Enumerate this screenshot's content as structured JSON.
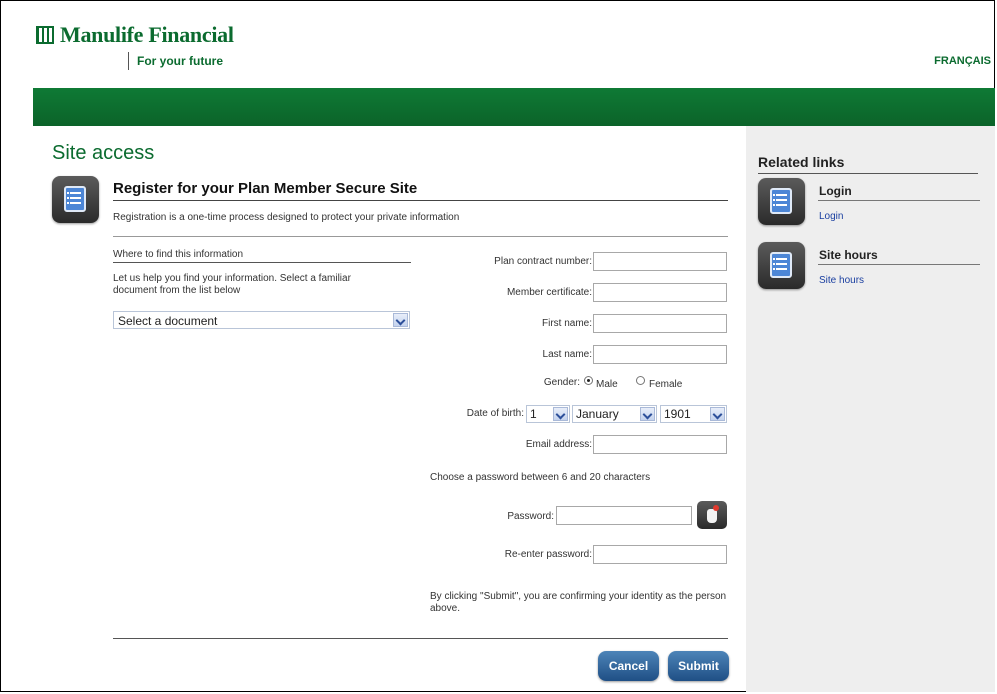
{
  "header": {
    "brand": "Manulife Financial",
    "tagline": "For your future",
    "language_link": "FRANÇAIS",
    "brand_color": "#0b6b2f"
  },
  "main": {
    "page_title": "Site access",
    "section_title": "Register for your Plan Member Secure Site",
    "intro": "Registration is a one-time process designed to protect your private information",
    "where_heading": "Where to find this information",
    "where_text": "Let us help you find your information. Select a familiar document from the list below",
    "document_select": "Select a document",
    "icon": "document-list-icon"
  },
  "form": {
    "plan_contract_label": "Plan contract number:",
    "member_certificate_label": "Member certificate:",
    "first_name_label": "First name:",
    "last_name_label": "Last name:",
    "gender_label": "Gender:",
    "gender_options": [
      "Male",
      "Female"
    ],
    "gender_selected": "Male",
    "dob_label": "Date of birth:",
    "dob_day": "1",
    "dob_month": "January",
    "dob_year": "1901",
    "email_label": "Email address:",
    "password_hint": "Choose a password between 6 and 20 characters",
    "password_label": "Password:",
    "reenter_label": "Re-enter password:",
    "confirm_text": "By clicking \"Submit\", you are confirming your identity as the person above.",
    "cancel": "Cancel",
    "submit": "Submit",
    "password_help_icon": "hand-pointer-icon"
  },
  "sidebar": {
    "title": "Related links",
    "items": [
      {
        "heading": "Login",
        "link": "Login",
        "icon": "document-list-icon"
      },
      {
        "heading": "Site hours",
        "link": "Site hours",
        "icon": "document-list-icon"
      }
    ]
  },
  "colors": {
    "header_bar": "#0f7a35",
    "sidebar_bg": "#eeeeee",
    "button": "#2b6aa5",
    "link": "#1a3fa0"
  }
}
